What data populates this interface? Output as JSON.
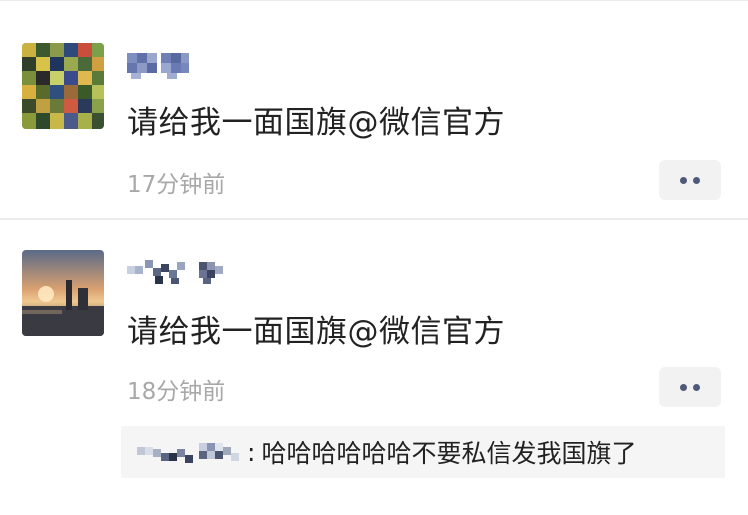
{
  "posts": [
    {
      "content": "请给我一面国旗@微信官方",
      "time": "17分钟前"
    },
    {
      "content": "请给我一面国旗@微信官方",
      "time": "18分钟前",
      "reply": {
        "separator": ":",
        "text": "哈哈哈哈哈哈不要私信发我国旗了"
      }
    }
  ],
  "icons": {
    "more": "more-dots-icon"
  },
  "colors": {
    "text": "#222222",
    "time": "#a8a8a8",
    "more_button_bg": "#f2f2f2",
    "more_dots": "#4f5a7a",
    "reply_bg": "#f5f5f5",
    "divider": "#ececec"
  }
}
